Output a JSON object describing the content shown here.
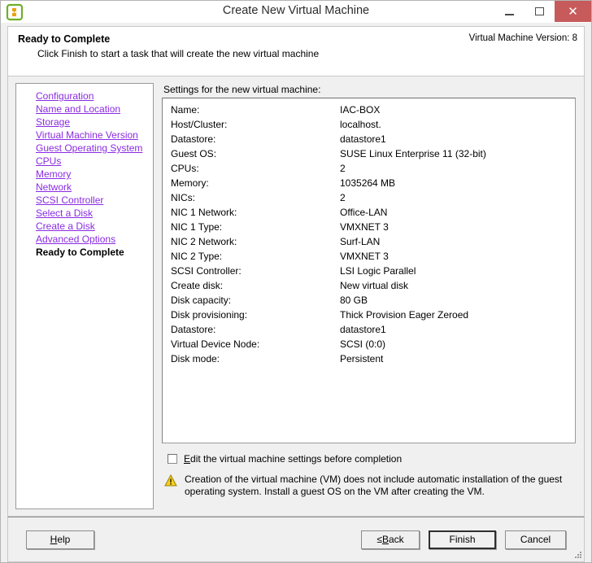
{
  "window": {
    "title": "Create New Virtual Machine",
    "app_icon": "vmware-vm-icon",
    "controls": {
      "minimize": "minimize-icon",
      "maximize": "maximize-icon",
      "close": "close-icon",
      "close_color": "#c75b5b"
    }
  },
  "header": {
    "title": "Ready to Complete",
    "subtitle": "Click Finish to start a task that will create the new virtual machine",
    "version": "Virtual Machine Version: 8"
  },
  "sidebar": {
    "link_color": "#8a2be2",
    "items": [
      {
        "label": "Configuration",
        "current": false
      },
      {
        "label": "Name and Location",
        "current": false
      },
      {
        "label": "Storage",
        "current": false
      },
      {
        "label": "Virtual Machine Version",
        "current": false
      },
      {
        "label": "Guest Operating System",
        "current": false
      },
      {
        "label": "CPUs",
        "current": false
      },
      {
        "label": "Memory",
        "current": false
      },
      {
        "label": "Network",
        "current": false
      },
      {
        "label": "SCSI Controller",
        "current": false
      },
      {
        "label": "Select a Disk",
        "current": false
      },
      {
        "label": "Create a Disk",
        "current": false
      },
      {
        "label": "Advanced Options",
        "current": false
      },
      {
        "label": "Ready to Complete",
        "current": true
      }
    ]
  },
  "main": {
    "settings_label": "Settings for the new virtual machine:",
    "settings": [
      {
        "key": "Name:",
        "value": "IAC-BOX"
      },
      {
        "key": "Host/Cluster:",
        "value": "localhost."
      },
      {
        "key": "Datastore:",
        "value": "datastore1"
      },
      {
        "key": "Guest OS:",
        "value": "SUSE Linux Enterprise 11 (32-bit)"
      },
      {
        "key": "CPUs:",
        "value": "2"
      },
      {
        "key": "Memory:",
        "value": "1035264 MB"
      },
      {
        "key": "NICs:",
        "value": "2"
      },
      {
        "key": "NIC 1 Network:",
        "value": "Office-LAN"
      },
      {
        "key": "NIC 1 Type:",
        "value": "VMXNET 3"
      },
      {
        "key": "NIC 2 Network:",
        "value": "Surf-LAN"
      },
      {
        "key": "NIC 2 Type:",
        "value": "VMXNET 3"
      },
      {
        "key": "SCSI Controller:",
        "value": "LSI Logic Parallel"
      },
      {
        "key": "Create disk:",
        "value": "New virtual disk"
      },
      {
        "key": "Disk capacity:",
        "value": "80 GB"
      },
      {
        "key": "Disk provisioning:",
        "value": "Thick Provision Eager Zeroed"
      },
      {
        "key": "Datastore:",
        "value": "datastore1"
      },
      {
        "key": "Virtual Device Node:",
        "value": "SCSI (0:0)"
      },
      {
        "key": "Disk mode:",
        "value": "Persistent"
      }
    ],
    "edit_checkbox": {
      "label_before": "",
      "label_accel": "E",
      "label_after": "dit the virtual machine settings before completion",
      "checked": false
    },
    "warning": {
      "icon": "warning-triangle-icon",
      "icon_color": "#f5d020",
      "text": "Creation of the virtual machine (VM) does not include automatic installation of the guest operating system. Install a guest OS on the VM after creating the VM."
    }
  },
  "footer": {
    "help": {
      "accel": "H",
      "before": "",
      "after": "elp"
    },
    "back": {
      "prefix": "≤ ",
      "accel": "B",
      "after": "ack"
    },
    "finish": "Finish",
    "cancel": "Cancel",
    "grip": "resize-grip-icon"
  }
}
